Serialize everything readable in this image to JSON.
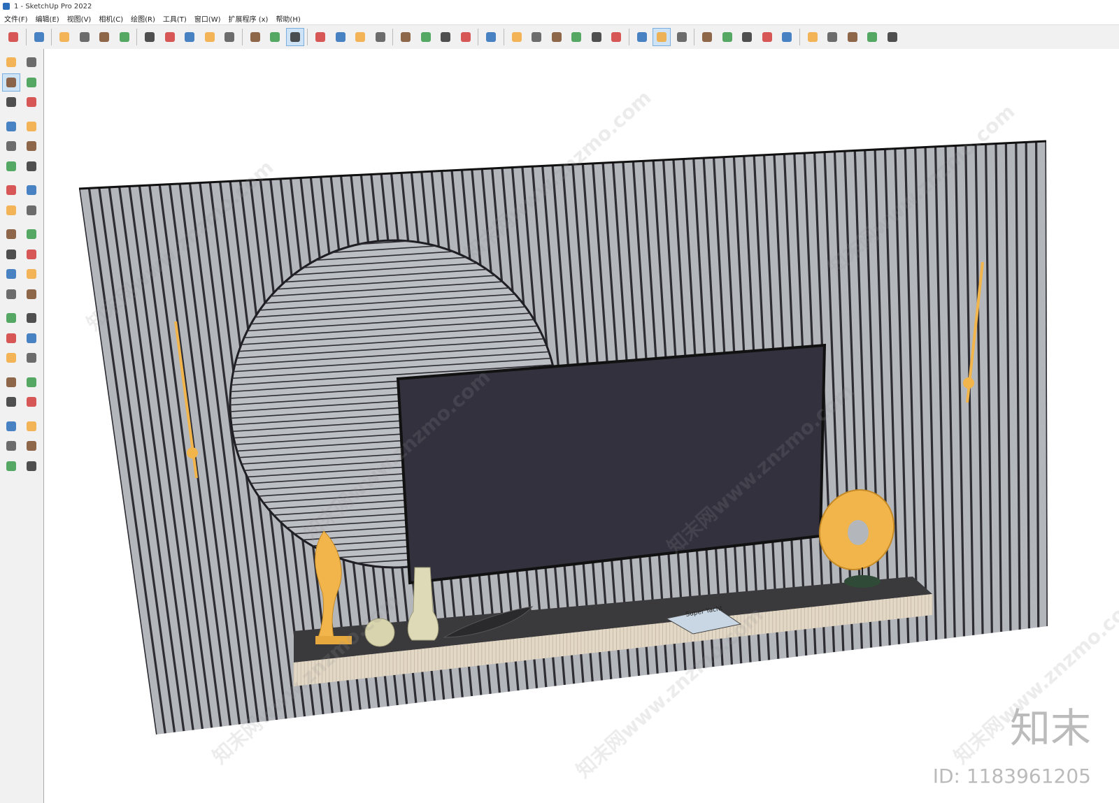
{
  "window": {
    "title": "1 - SketchUp Pro 2022"
  },
  "menu": [
    "文件(F)",
    "编辑(E)",
    "视图(V)",
    "相机(C)",
    "绘图(R)",
    "工具(T)",
    "窗口(W)",
    "扩展程序 (x)",
    "帮助(H)"
  ],
  "toolbar_icons": [
    "zoom-icon",
    "select-icon",
    "eraser-icon",
    "line-icon",
    "arc-icon",
    "rectangle-icon",
    "push-pull-icon",
    "follow-me-icon",
    "move-icon",
    "rotate-icon",
    "scale-icon",
    "tape-icon",
    "text-icon",
    "paint-bucket-icon",
    "orbit-icon",
    "pan-icon",
    "zoom-window-icon",
    "zoom-extents-icon",
    "warehouse-icon",
    "sandbox-icon",
    "layers-icon",
    "styles-icon",
    "account-icon",
    "iso-view-icon",
    "front-view-icon",
    "top-view-icon",
    "back-view-icon",
    "left-view-icon",
    "right-view-icon",
    "section-icon",
    "outliner-icon",
    "components-icon",
    "add-location-icon",
    "shadow-icon",
    "fog-icon",
    "match-photo-icon",
    "cloud-icon",
    "settings-icon",
    "scenes-icon",
    "info-icon",
    "cart-icon",
    "user-icon"
  ],
  "left_tools": [
    "select",
    "orbit",
    "paint",
    "eraser",
    "component",
    "tape",
    "pencil",
    "freehand",
    "rectangle",
    "rotated-rect",
    "circle",
    "polygon",
    "arc",
    "pie",
    "arc-3pt",
    "protractor",
    "move",
    "push-pull",
    "rotate",
    "follow-me",
    "scale",
    "offset",
    "tape-measure",
    "text",
    "axes",
    "dimension",
    "orbit",
    "pan",
    "zoom",
    "zoom-window",
    "zoom-extents",
    "previous",
    "position-camera",
    "look-around",
    "walk",
    "section-plane",
    "sandbox",
    "smoove",
    "stamp",
    "drape"
  ],
  "watermark": {
    "text": "知末网www.znzmo.com",
    "brand": "知末",
    "model_id": "ID: 1183961205"
  },
  "magazine_title": "Super Yacht",
  "colors": {
    "wall": "#b3b6bb",
    "wall_groove": "#2d2d33",
    "tv": "#33313d",
    "cabinet_top": "#3a3a3c",
    "cabinet_front": "#e3d8c6",
    "gold": "#f1b54c",
    "accent_blue": "#2a6ebb"
  }
}
